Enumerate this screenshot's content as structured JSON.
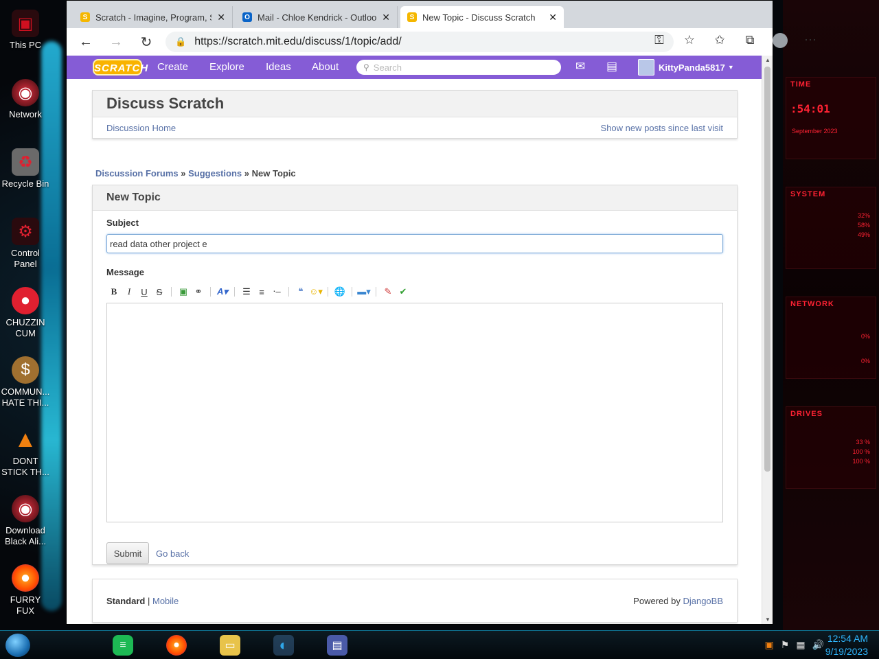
{
  "desktop": {
    "icons": [
      {
        "label": "This PC",
        "icon": "computer-icon",
        "color": "#d01020"
      },
      {
        "label": "Network",
        "icon": "network-icon",
        "color": "#b0101a"
      },
      {
        "label": "Recycle Bin",
        "icon": "recycle-bin-icon",
        "color": "#c01020"
      },
      {
        "label": "Control\nPanel",
        "icon": "control-panel-icon",
        "color": "#c01020"
      },
      {
        "label": "CHUZZIN\nCUM",
        "icon": "chuzzle-icon",
        "color": "#e02030"
      },
      {
        "label": "COMMUN...\nHATE THI...",
        "icon": "money-bag-icon",
        "color": "#a07030"
      },
      {
        "label": "DONT\nSTICK TH...",
        "icon": "vlc-cone-icon",
        "color": "#f08010"
      },
      {
        "label": "Download\nBlack Ali...",
        "icon": "alienware-icon",
        "color": "#b0101a"
      },
      {
        "label": "FURRY\nFUX",
        "icon": "firefox-icon",
        "color": "#ff6a00"
      }
    ],
    "widgets": {
      "time_title": "TIME",
      "time_value": ":54:01",
      "date_value": "September 2023",
      "system_title": "SYSTEM",
      "system_vals": [
        "32%",
        "58%",
        "49%"
      ],
      "network_title": "NETWORK",
      "network_vals": [
        "0%",
        "0%"
      ],
      "drives_title": "DRIVES",
      "drives_vals": [
        "33 %",
        "100 %",
        "100 %"
      ]
    }
  },
  "browser": {
    "tabs": [
      {
        "title": "Scratch - Imagine, Program, Sha",
        "favicon": "scratch-favicon"
      },
      {
        "title": "Mail - Chloe Kendrick - Outlook",
        "favicon": "outlook-favicon"
      },
      {
        "title": "New Topic - Discuss Scratch",
        "favicon": "scratch-favicon"
      }
    ],
    "url": "https://scratch.mit.edu/discuss/1/topic/add/"
  },
  "scratch": {
    "logo": "SCRATCH",
    "nav": {
      "create": "Create",
      "explore": "Explore",
      "ideas": "Ideas",
      "about": "About"
    },
    "search_placeholder": "Search",
    "username": "KittyPanda5817",
    "discuss_title": "Discuss Scratch",
    "discussion_home": "Discussion Home",
    "show_new_posts": "Show new posts since last visit",
    "breadcrumb": {
      "forums": "Discussion Forums",
      "sep1": "»",
      "suggestions": "Suggestions",
      "sep2": "»",
      "current": "New Topic"
    },
    "new_topic_title": "New Topic",
    "subject_label": "Subject",
    "subject_value": "read data other project e",
    "message_label": "Message",
    "toolbar": {
      "bold": "B",
      "italic": "I",
      "underline": "U",
      "strike": "S"
    },
    "submit": "Submit",
    "go_back": "Go back",
    "footer": {
      "standard": "Standard",
      "pipe": "|",
      "mobile": "Mobile",
      "powered": "Powered by",
      "djangobb": "DjangoBB"
    }
  },
  "taskbar": {
    "time": "12:54 AM",
    "date": "9/19/2023"
  },
  "colors": {
    "scratch_purple": "#855cd6",
    "link": "#5770a6",
    "clock": "#2fb7ff"
  }
}
